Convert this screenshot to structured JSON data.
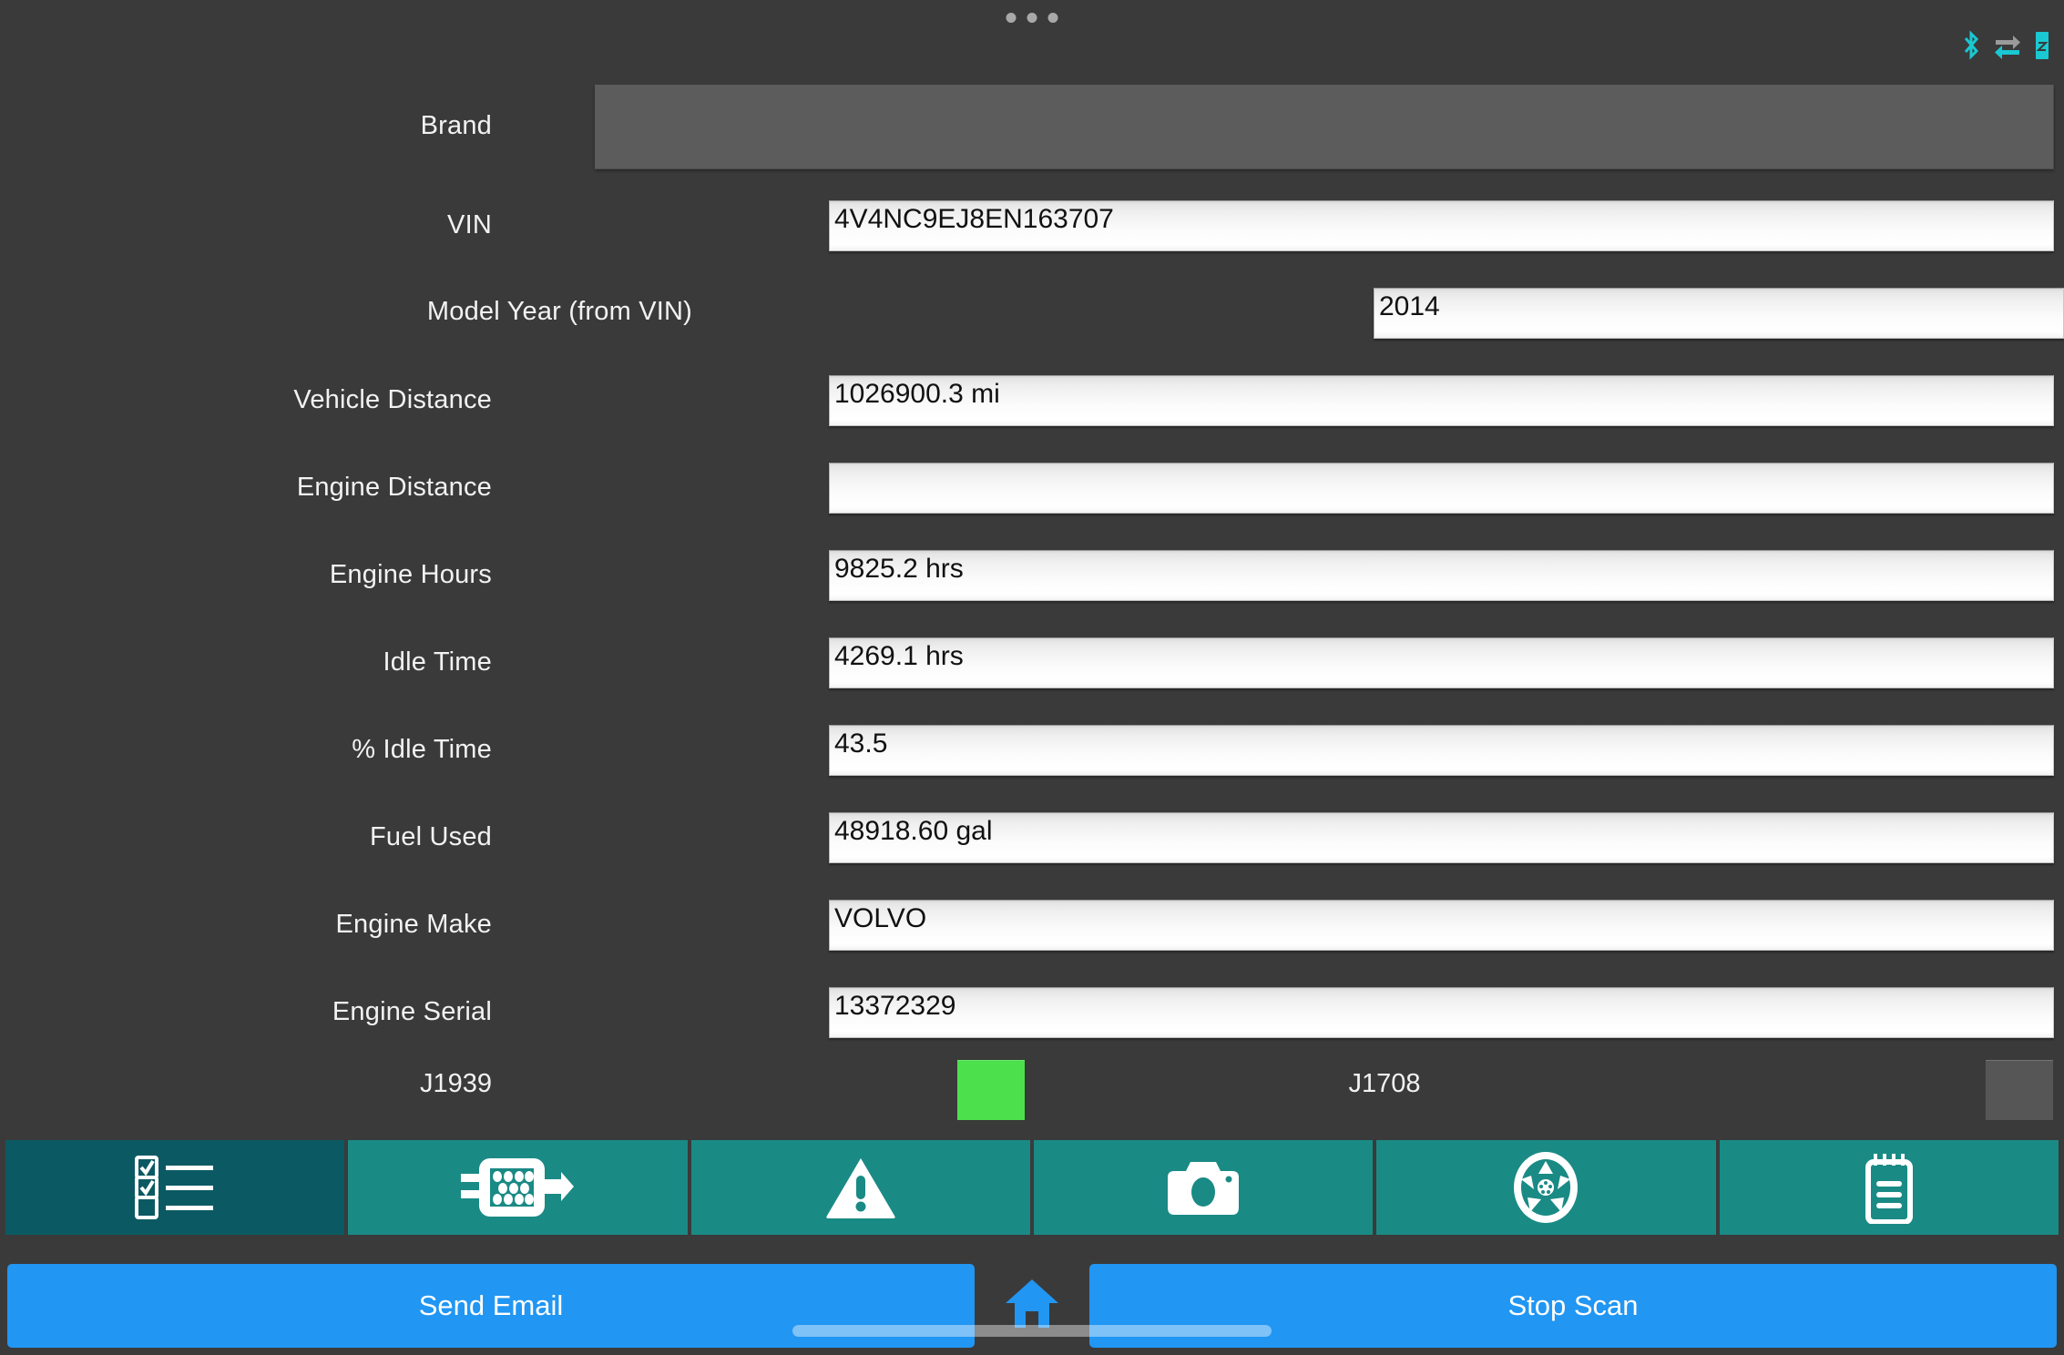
{
  "status_bar": {
    "drag_handle": "•••",
    "icons": [
      {
        "name": "bluetooth-icon",
        "color": "#19c8d2"
      },
      {
        "name": "data-transfer-icon",
        "color": "#19c8d2"
      },
      {
        "name": "device-battery-icon",
        "color": "#19c8d2"
      }
    ]
  },
  "form": {
    "rows": [
      {
        "label": "Brand",
        "value": "",
        "type": "spinner"
      },
      {
        "label": "VIN",
        "value": "4V4NC9EJ8EN163707",
        "type": "text"
      },
      {
        "label": "Model Year (from VIN)",
        "value": "2014",
        "type": "text"
      },
      {
        "label": "Vehicle Distance",
        "value": "1026900.3 mi",
        "type": "text"
      },
      {
        "label": "Engine Distance",
        "value": "",
        "type": "text"
      },
      {
        "label": "Engine Hours",
        "value": "9825.2 hrs",
        "type": "text"
      },
      {
        "label": "Idle Time",
        "value": "4269.1 hrs",
        "type": "text"
      },
      {
        "label": "% Idle Time",
        "value": "43.5",
        "type": "text"
      },
      {
        "label": "Fuel Used",
        "value": "48918.60 gal",
        "type": "text"
      },
      {
        "label": "Engine Make",
        "value": "VOLVO",
        "type": "text"
      },
      {
        "label": "Engine Serial",
        "value": "13372329",
        "type": "text"
      }
    ]
  },
  "protocols": [
    {
      "label": "J1939",
      "state": "active",
      "color": "#4ce04c"
    },
    {
      "label": "J1708",
      "state": "inactive",
      "color": "#565656"
    }
  ],
  "tabs": [
    {
      "name": "checklist",
      "icon": "checklist-icon",
      "active": true
    },
    {
      "name": "diagnostic-connector",
      "icon": "obd-connector-icon",
      "active": false
    },
    {
      "name": "faults",
      "icon": "warning-triangle-icon",
      "active": false
    },
    {
      "name": "photos",
      "icon": "camera-icon",
      "active": false
    },
    {
      "name": "wheels",
      "icon": "wheel-icon",
      "active": false
    },
    {
      "name": "notes",
      "icon": "notepad-icon",
      "active": false
    }
  ],
  "actions": {
    "send_email": "Send Email",
    "home": "home-icon",
    "stop_scan": "Stop Scan"
  },
  "colors": {
    "background": "#3a3a3a",
    "tab_inactive": "#1a8a85",
    "tab_active": "#0b5a63",
    "button_blue": "#2196f3",
    "accent_cyan": "#19c8d2",
    "led_on": "#4ce04c",
    "led_off": "#565656"
  }
}
